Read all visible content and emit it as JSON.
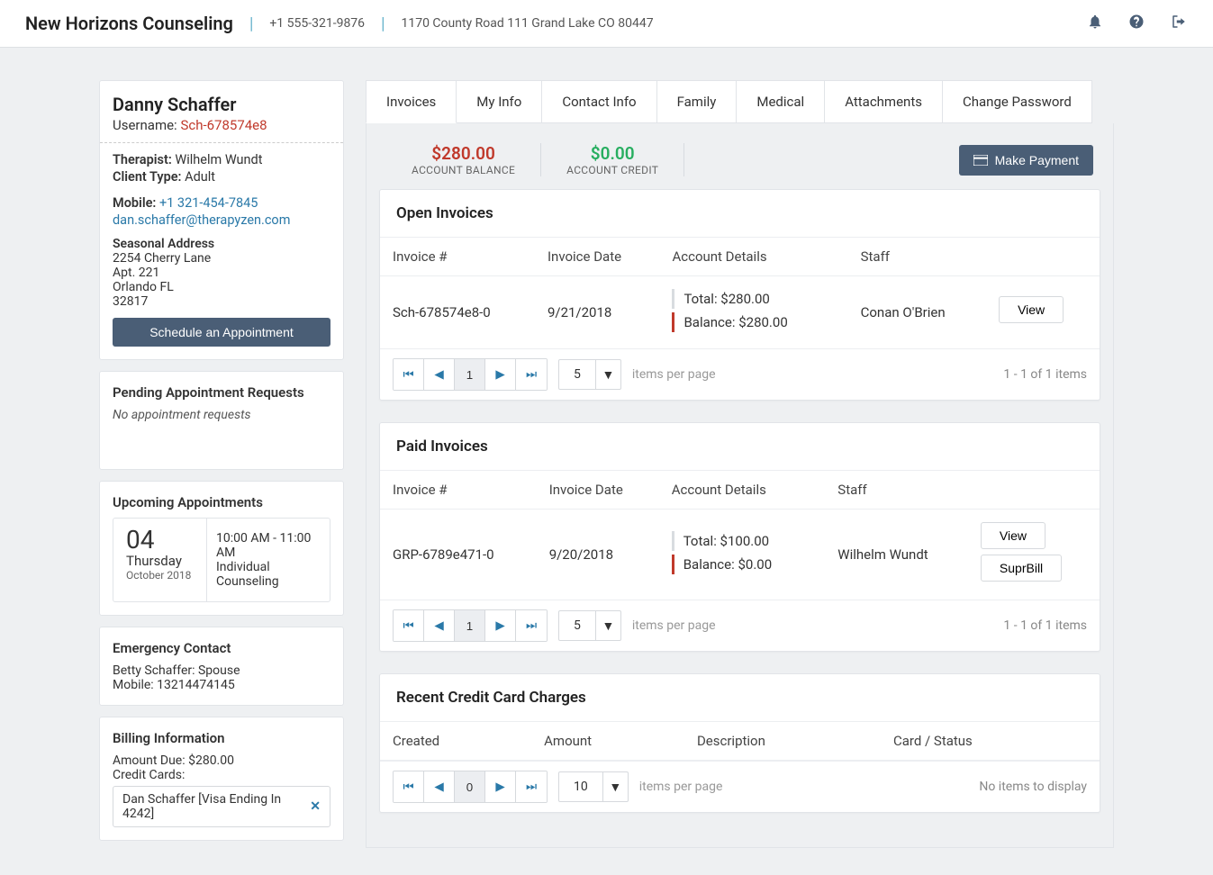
{
  "header": {
    "brand": "New Horizons Counseling",
    "phone": "+1 555-321-9876",
    "address": "1170 County Road 111 Grand Lake CO 80447"
  },
  "client": {
    "name": "Danny Schaffer",
    "username_label": "Username:",
    "username": "Sch-678574e8",
    "therapist_label": "Therapist:",
    "therapist": "Wilhelm Wundt",
    "client_type_label": "Client Type:",
    "client_type": "Adult",
    "mobile_label": "Mobile:",
    "mobile": "+1 321-454-7845",
    "email": "dan.schaffer@therapyzen.com",
    "address_label": "Seasonal Address",
    "addr1": "2254 Cherry Lane",
    "addr2": "Apt. 221",
    "addr3": "Orlando FL",
    "addr4": "32817",
    "schedule_btn": "Schedule an Appointment"
  },
  "pending": {
    "title": "Pending Appointment Requests",
    "empty": "No appointment requests"
  },
  "upcoming": {
    "title": "Upcoming Appointments",
    "day": "04",
    "dow": "Thursday",
    "month": "October 2018",
    "time": "10:00 AM - 11:00 AM",
    "type": "Individual Counseling"
  },
  "emergency": {
    "title": "Emergency Contact",
    "line1": "Betty Schaffer: Spouse",
    "line2": "Mobile: 13214474145"
  },
  "billing": {
    "title": "Billing Information",
    "amount_due": "Amount Due: $280.00",
    "cc_label": "Credit Cards:",
    "card": "Dan Schaffer [Visa Ending In 4242]"
  },
  "tabs": [
    "Invoices",
    "My Info",
    "Contact Info",
    "Family",
    "Medical",
    "Attachments",
    "Change Password"
  ],
  "balance": {
    "amount": "$280.00",
    "label": "ACCOUNT BALANCE"
  },
  "credit": {
    "amount": "$0.00",
    "label": "ACCOUNT CREDIT"
  },
  "make_payment": "Make Payment",
  "open_invoices": {
    "title": "Open Invoices",
    "headers": [
      "Invoice #",
      "Invoice Date",
      "Account Details",
      "Staff"
    ],
    "row": {
      "num": "Sch-678574e8-0",
      "date": "9/21/2018",
      "total": "Total: $280.00",
      "balance": "Balance: $280.00",
      "staff": "Conan O'Brien",
      "view": "View"
    },
    "per_page": "5",
    "page_num": "1",
    "per_page_label": "items per page",
    "info": "1 - 1 of 1 items"
  },
  "paid_invoices": {
    "title": "Paid Invoices",
    "headers": [
      "Invoice #",
      "Invoice Date",
      "Account Details",
      "Staff"
    ],
    "row": {
      "num": "GRP-6789e471-0",
      "date": "9/20/2018",
      "total": "Total: $100.00",
      "balance": "Balance: $0.00",
      "staff": "Wilhelm Wundt",
      "view": "View",
      "suprbill": "SuprBill"
    },
    "per_page": "5",
    "page_num": "1",
    "per_page_label": "items per page",
    "info": "1 - 1 of 1 items"
  },
  "charges": {
    "title": "Recent Credit Card Charges",
    "headers": [
      "Created",
      "Amount",
      "Description",
      "Card / Status"
    ],
    "per_page": "10",
    "page_num": "0",
    "per_page_label": "items per page",
    "info": "No items to display"
  }
}
